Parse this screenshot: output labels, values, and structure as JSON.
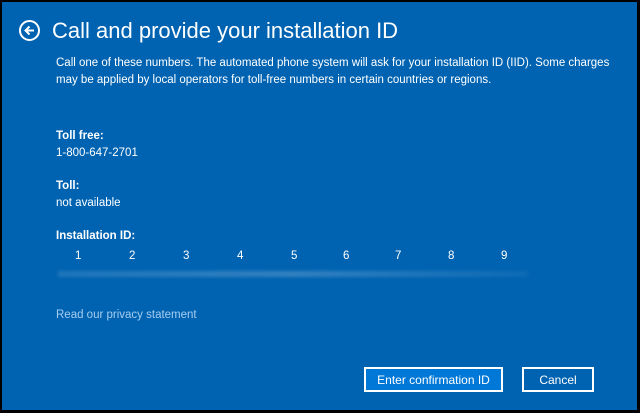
{
  "header": {
    "title": "Call and provide your installation ID",
    "back_icon": "arrow-left-circle-icon"
  },
  "description": "Call one of these numbers. The automated phone system will ask for your installation ID (IID). Some charges may be applied by local operators for toll-free numbers in certain countries or regions.",
  "toll_free": {
    "label": "Toll free:",
    "value": "1-800-647-2701"
  },
  "toll": {
    "label": "Toll:",
    "value": "not available"
  },
  "installation_id": {
    "label": "Installation ID:",
    "columns": [
      "1",
      "2",
      "3",
      "4",
      "5",
      "6",
      "7",
      "8",
      "9"
    ]
  },
  "privacy_link": "Read our privacy statement",
  "buttons": {
    "enter": "Enter confirmation ID",
    "cancel": "Cancel"
  },
  "colors": {
    "background": "#0063b1",
    "primary_button": "#0078d7",
    "link": "#a6cdf0"
  }
}
